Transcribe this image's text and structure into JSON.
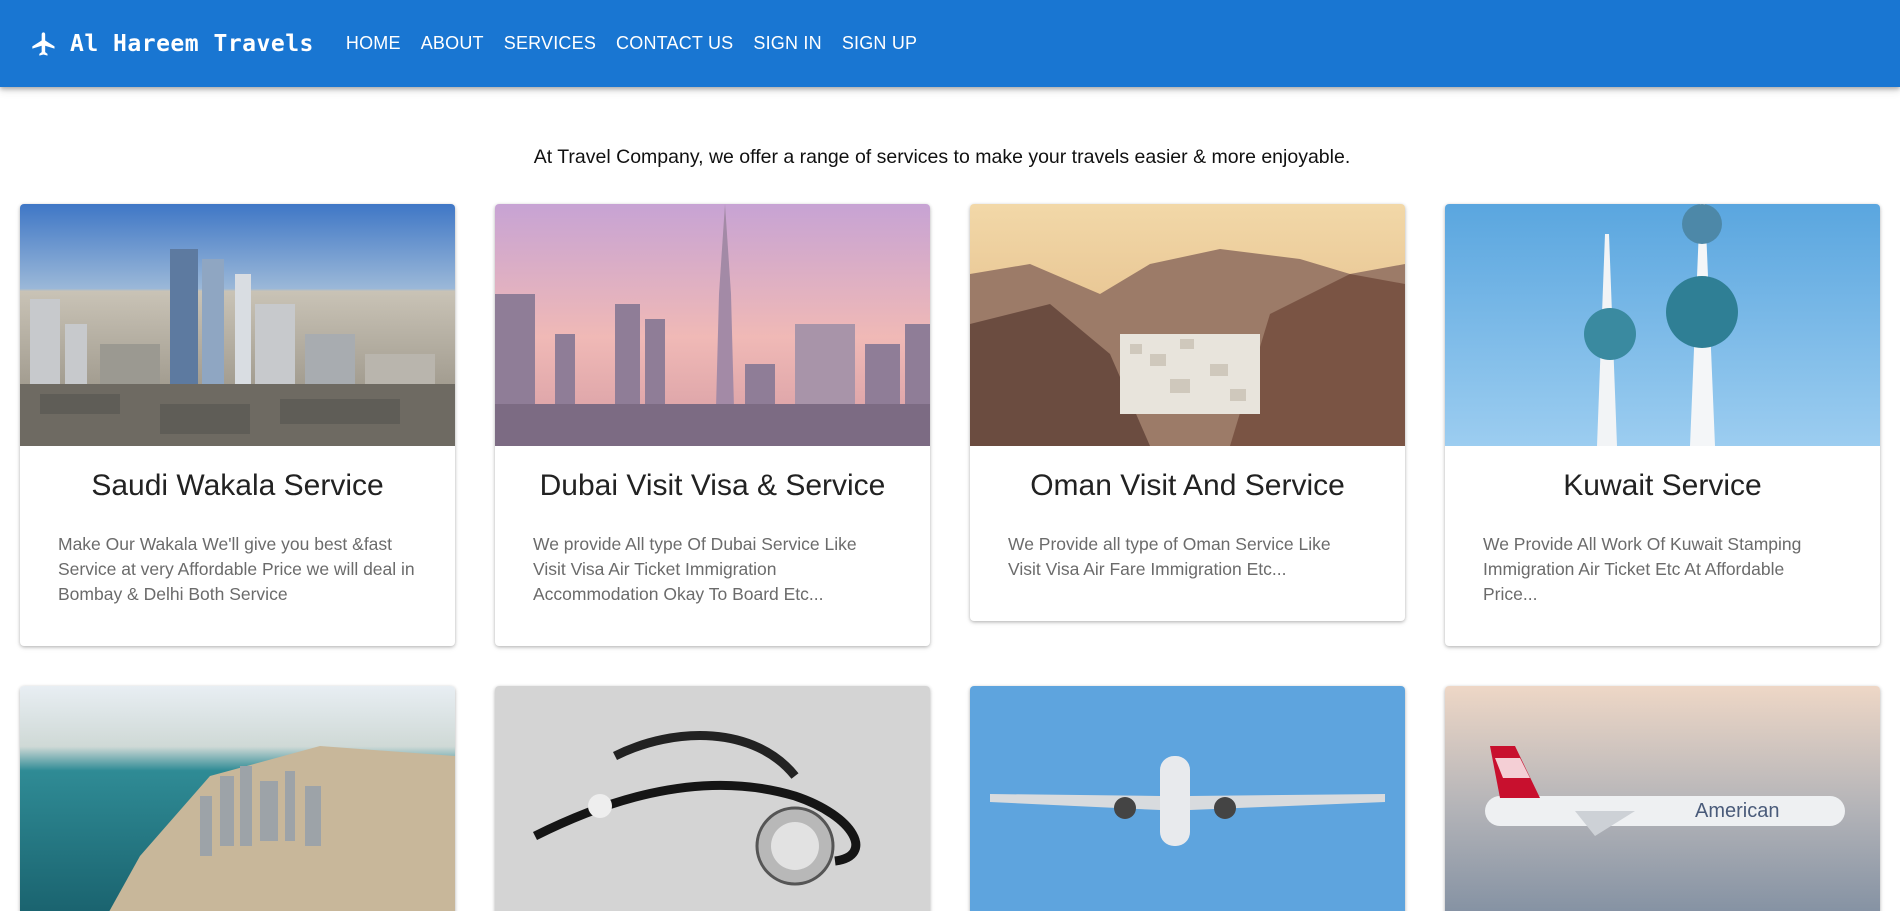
{
  "brand": {
    "name": "Al Hareem Travels",
    "icon": "airplane-icon"
  },
  "nav": {
    "links": [
      "HOME",
      "ABOUT",
      "SERVICES",
      "CONTACT US",
      "SIGN IN",
      "SIGN UP"
    ]
  },
  "intro": "At Travel Company, we offer a range of services to make your travels easier & more enjoyable.",
  "colors": {
    "navbar": "#1976d2",
    "nav_text": "#ffffff",
    "card_text": "#6b6b6b"
  },
  "cards": [
    {
      "title": "Saudi Wakala Service",
      "text": "Make Our Wakala We'll give you best &fast Service at very Affordable Price we will deal in Bombay & Delhi Both Service"
    },
    {
      "title": "Dubai Visit Visa & Service",
      "text": "We provide All type Of Dubai Service Like Visit Visa Air Ticket Immigration Accommodation Okay To Board Etc..."
    },
    {
      "title": "Oman Visit And Service",
      "text": "We Provide all type of Oman Service Like Visit Visa Air Fare Immigration Etc..."
    },
    {
      "title": "Kuwait Service",
      "text": "We Provide All Work Of Kuwait Stamping Immigration Air Ticket Etc At Affordable Price..."
    }
  ],
  "row2_airline_label": "American"
}
